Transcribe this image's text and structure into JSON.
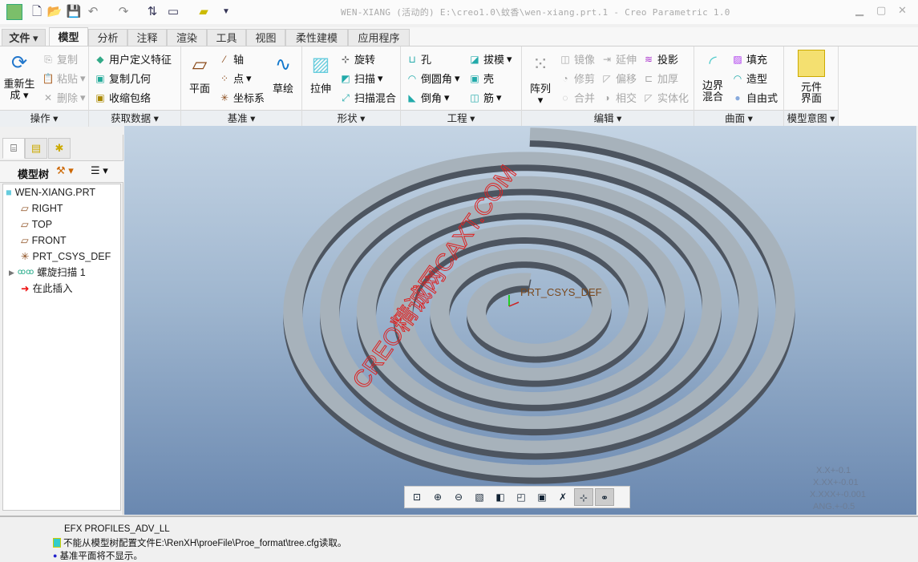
{
  "window": {
    "title": "WEN-XIANG (活动的) E:\\creo1.0\\蚊香\\wen-xiang.prt.1 - Creo Parametric 1.0"
  },
  "tabs": [
    {
      "label": "文件"
    },
    {
      "label": "模型"
    },
    {
      "label": "分析"
    },
    {
      "label": "注释"
    },
    {
      "label": "渲染"
    },
    {
      "label": "工具"
    },
    {
      "label": "视图"
    },
    {
      "label": "柔性建模"
    },
    {
      "label": "应用程序"
    }
  ],
  "ribbon": {
    "ops": {
      "label": "操作",
      "regen": "重新生成",
      "copy": "复制",
      "paste": "粘贴",
      "delete": "删除"
    },
    "getdata": {
      "label": "获取数据",
      "udf": "用户定义特征",
      "copygeom": "复制几何",
      "shrinkwrap": "收缩包络"
    },
    "datum": {
      "label": "基准",
      "plane": "平面",
      "axis": "轴",
      "point": "点",
      "csys": "坐标系",
      "sketch": "草绘"
    },
    "shapes": {
      "label": "形状",
      "extrude": "拉伸",
      "revolve": "旋转",
      "sweep": "扫描",
      "sweptblend": "扫描混合"
    },
    "eng": {
      "label": "工程",
      "hole": "孔",
      "round": "倒圆角",
      "chamfer": "倒角",
      "draft": "拔模",
      "shell": "壳",
      "rib": "筋"
    },
    "edit": {
      "label": "编辑",
      "pattern": "阵列",
      "mirror": "镜像",
      "extend": "延伸",
      "project": "投影",
      "trim": "修剪",
      "offset": "偏移",
      "thicken": "加厚",
      "merge": "合并",
      "intersect": "相交",
      "solidify": "实体化"
    },
    "surf": {
      "label": "曲面",
      "boundary": "边界混合",
      "fill": "填充",
      "style": "造型",
      "freestyle": "自由式"
    },
    "intent": {
      "label": "模型意图",
      "component": "元件界面"
    }
  },
  "tree": {
    "header": "模型树",
    "items": [
      {
        "label": "WEN-XIANG.PRT"
      },
      {
        "label": "RIGHT"
      },
      {
        "label": "TOP"
      },
      {
        "label": "FRONT"
      },
      {
        "label": "PRT_CSYS_DEF"
      },
      {
        "label": "螺旋扫描 1"
      },
      {
        "label": "在此插入"
      }
    ]
  },
  "viewport": {
    "csys_label": "PRT_CSYS_DEF",
    "watermark": "CREO精诚网CAXT.COM",
    "tolerances": [
      "X.X+-0.1",
      "X.XX+-0.01",
      "X.XXX+-0.001",
      "ANG.+-0.5"
    ],
    "model_color": "#a7b2bb"
  },
  "messages": [
    "EFX PROFILES_ADV_LL",
    "不能从模型树配置文件E:\\RenXH\\proeFile\\Proe_format\\tree.cfg读取。",
    "基准平面将不显示。"
  ]
}
